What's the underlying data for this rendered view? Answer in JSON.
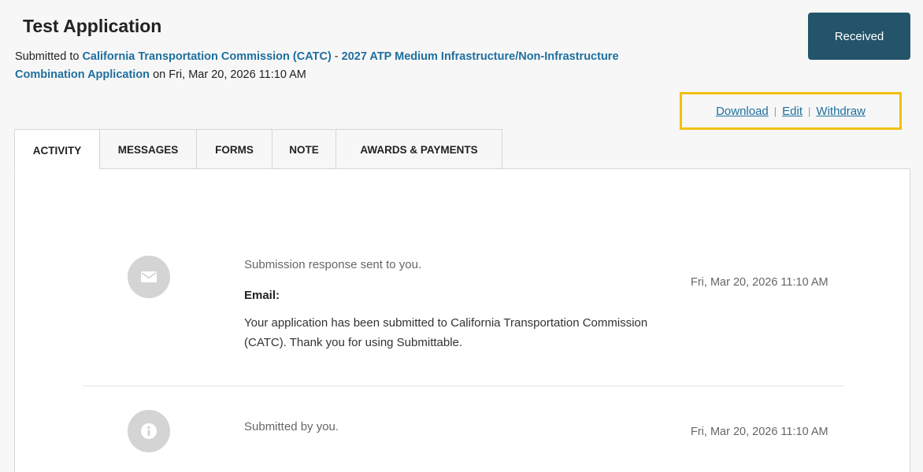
{
  "header": {
    "title": "Test Application",
    "submitted_prefix": "Submitted to ",
    "organization": "California Transportation Commission (CATC)",
    "dash": " - ",
    "form_name": "2027 ATP Medium Infrastructure/Non-Infrastructure Combination Application",
    "date_prefix": " on Fri, Mar 20, 2026 11:10 AM",
    "status_button": "Received"
  },
  "actions": {
    "download": "Download",
    "edit": "Edit",
    "withdraw": "Withdraw",
    "separator": "|"
  },
  "tabs": [
    {
      "label": "ACTIVITY"
    },
    {
      "label": "MESSAGES"
    },
    {
      "label": "FORMS"
    },
    {
      "label": "NOTE"
    },
    {
      "label": "AWARDS & PAYMENTS"
    }
  ],
  "activity": [
    {
      "icon": "envelope-icon",
      "text": "Submission response sent to you.",
      "label": "Email:",
      "body": "Your application has been submitted to California Transportation Commission (CATC). Thank you for using Submittable.",
      "time": "Fri, Mar 20, 2026 11:10 AM"
    },
    {
      "icon": "info-icon",
      "text": "Submitted by you.",
      "time": "Fri, Mar 20, 2026 11:10 AM"
    }
  ],
  "colors": {
    "link": "#1f6f9e",
    "status_button_bg": "#23546a",
    "highlight_border": "#f0c010"
  }
}
